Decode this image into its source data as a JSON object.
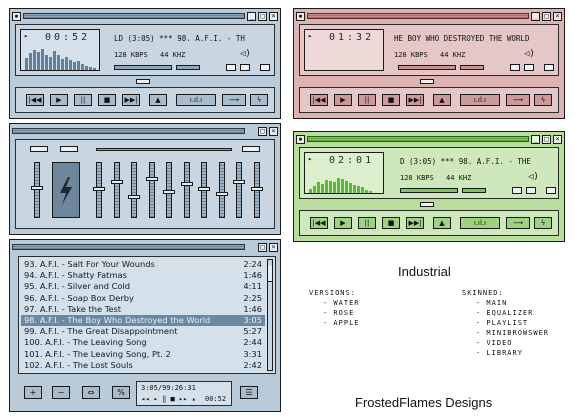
{
  "main_water": {
    "time": "00:52",
    "marquee": "LD (3:05)  *** 98. A.F.I. - TH",
    "bitrate": "128 KBPS",
    "samplerate": "44 KHZ",
    "vis_bars": [
      0.55,
      0.75,
      0.9,
      0.8,
      0.95,
      0.7,
      0.6,
      0.85,
      0.7,
      0.5,
      0.6,
      0.45,
      0.35,
      0.4,
      0.25,
      0.2,
      0.15,
      0.1
    ]
  },
  "main_rose": {
    "time": "01:32",
    "marquee": "HE BOY WHO DESTROYED THE WORLD",
    "bitrate": "128 KBPS",
    "samplerate": "44 KHZ"
  },
  "main_apple": {
    "time": "02:01",
    "marquee": "D (3:05)  *** 98. A.F.I. - THE",
    "bitrate": "128 KBPS",
    "samplerate": "44 KHZ",
    "vis_bars": [
      0.2,
      0.3,
      0.5,
      0.4,
      0.6,
      0.55,
      0.5,
      0.7,
      0.65,
      0.55,
      0.45,
      0.35,
      0.3,
      0.25,
      0.15,
      0.1
    ]
  },
  "transport": {
    "prev": "|◀◀",
    "play": "▶",
    "pause": "||",
    "stop": "■",
    "next": "▶▶|",
    "eject": "▲",
    "shuffle": "⟶",
    "repeat": "ϟ"
  },
  "equalizer": {
    "preamp_icon": "lightning-icon",
    "bands": [
      0.5,
      0.35,
      0.65,
      0.3,
      0.55,
      0.4,
      0.5,
      0.6,
      0.35,
      0.5
    ]
  },
  "playlist": {
    "rows": [
      {
        "title": "93. A.F.I. - Salt For Your Wounds",
        "duration": "2:24"
      },
      {
        "title": "94. A.F.I. - Shatty Fatmas",
        "duration": "1:46"
      },
      {
        "title": "95. A.F.I. - Silver and Cold",
        "duration": "4:11"
      },
      {
        "title": "96. A.F.I. - Soap Box Derby",
        "duration": "2:25"
      },
      {
        "title": "97. A.F.I. - Take the Test",
        "duration": "1:46"
      },
      {
        "title": "98. A.F.I. - The Boy Who Destroyed the World",
        "duration": "3:05"
      },
      {
        "title": "99. A.F.I. - The Great Disappointment",
        "duration": "5:27"
      },
      {
        "title": "100. A.F.I. - The Leaving Song",
        "duration": "2:44"
      },
      {
        "title": "101. A.F.I. - The Leaving Song, Pt. 2",
        "duration": "3:31"
      },
      {
        "title": "102. A.F.I. - The Lost Souls",
        "duration": "2:42"
      }
    ],
    "selected_index": 5,
    "add": "+",
    "remove": "−",
    "select": "⇔",
    "misc": "%",
    "list": "☰",
    "time_info": "3:05/99:26:31",
    "mini_time": "00:52"
  },
  "captions": {
    "title": "Industrial",
    "versions_header": "VERSIONS:",
    "versions": [
      "- WATER",
      "- ROSE",
      "- APPLE"
    ],
    "skinned_header": "SKINNED:",
    "skinned": [
      "- MAIN",
      "- EQUALIZER",
      "- PLAYLIST",
      "- MINIBROWSWER",
      "- VIDEO",
      "- LIBRARY"
    ],
    "credit": "FrostedFlames Designs"
  },
  "colors": {
    "water": "#b9cad8",
    "rose": "#dcb2b2",
    "apple": "#b9dd9c",
    "selection": "#6b88a3"
  }
}
